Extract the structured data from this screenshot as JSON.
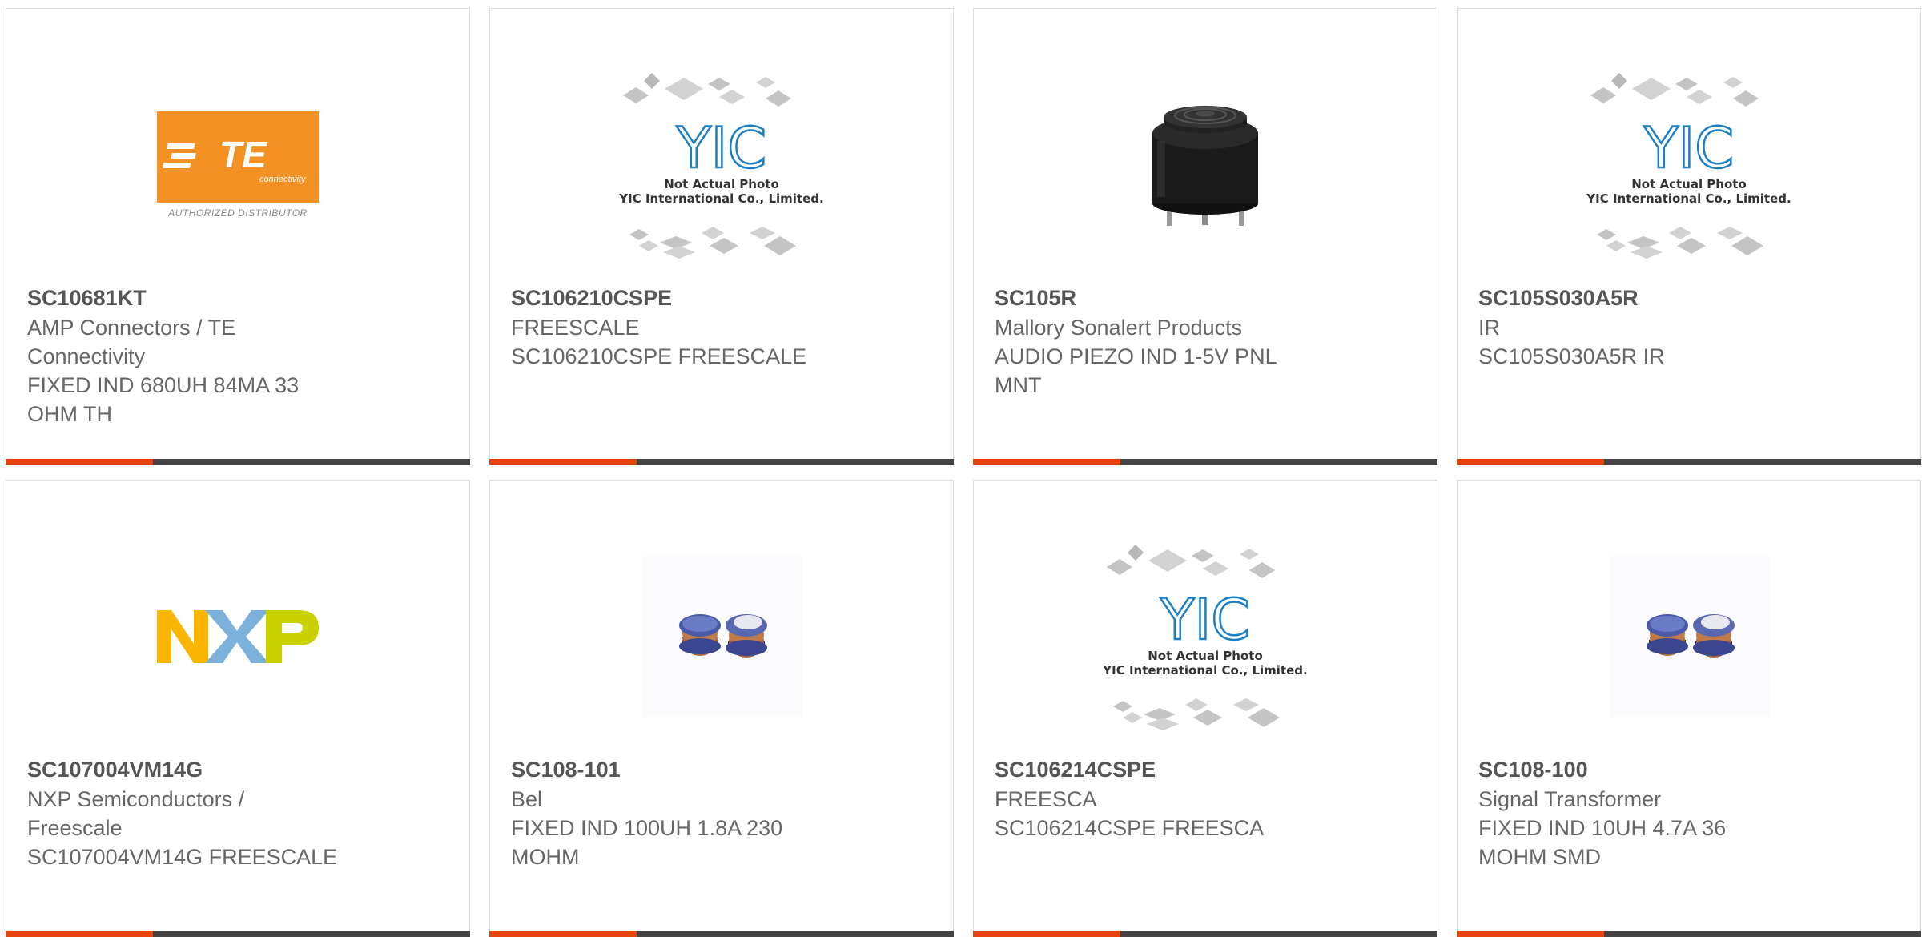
{
  "products": [
    {
      "part_number": "SC10681KT",
      "manufacturer": "AMP Connectors / TE Connectivity",
      "description": "FIXED IND 680UH 84MA 33 OHM TH",
      "image": "te-connectivity-logo",
      "logo": {
        "wordmark": "TE",
        "tagline": "connectivity",
        "caption": "AUTHORIZED DISTRIBUTOR"
      }
    },
    {
      "part_number": "SC106210CSPE",
      "manufacturer": "FREESCALE",
      "description": "SC106210CSPE FREESCALE",
      "image": "yic-not-actual-photo",
      "placeholder": {
        "brand": "YIC",
        "line1": "Not Actual Photo",
        "line2": "YIC International Co., Limited."
      }
    },
    {
      "part_number": "SC105R",
      "manufacturer": "Mallory Sonalert Products",
      "description": "AUDIO PIEZO IND 1-5V PNL MNT",
      "image": "piezo-buzzer-photo"
    },
    {
      "part_number": "SC105S030A5R",
      "manufacturer": "IR",
      "description": "SC105S030A5R IR",
      "image": "yic-not-actual-photo",
      "placeholder": {
        "brand": "YIC",
        "line1": "Not Actual Photo",
        "line2": "YIC International Co., Limited."
      }
    },
    {
      "part_number": "SC107004VM14G",
      "manufacturer": "NXP Semiconductors / Freescale",
      "description": "SC107004VM14G FREESCALE",
      "image": "nxp-logo",
      "logo": {
        "letters": [
          "N",
          "X",
          "P"
        ],
        "colors": [
          "#f9b500",
          "#7bb1db",
          "#c9d200"
        ]
      }
    },
    {
      "part_number": "SC108-101",
      "manufacturer": "Bel",
      "description": "FIXED IND 100UH 1.8A 230 MOHM",
      "image": "smd-inductor-photo"
    },
    {
      "part_number": "SC106214CSPE",
      "manufacturer": "FREESCA",
      "description": "SC106214CSPE FREESCA",
      "image": "yic-not-actual-photo",
      "placeholder": {
        "brand": "YIC",
        "line1": "Not Actual Photo",
        "line2": "YIC International Co., Limited."
      }
    },
    {
      "part_number": "SC108-100",
      "manufacturer": "Signal Transformer",
      "description": "FIXED IND 10UH 4.7A 36 MOHM SMD",
      "image": "smd-inductor-photo"
    }
  ],
  "colors": {
    "accent": "#e8430a",
    "bar": "#444444",
    "te_orange": "#f39122",
    "yic_blue": "#1a7fc4"
  }
}
